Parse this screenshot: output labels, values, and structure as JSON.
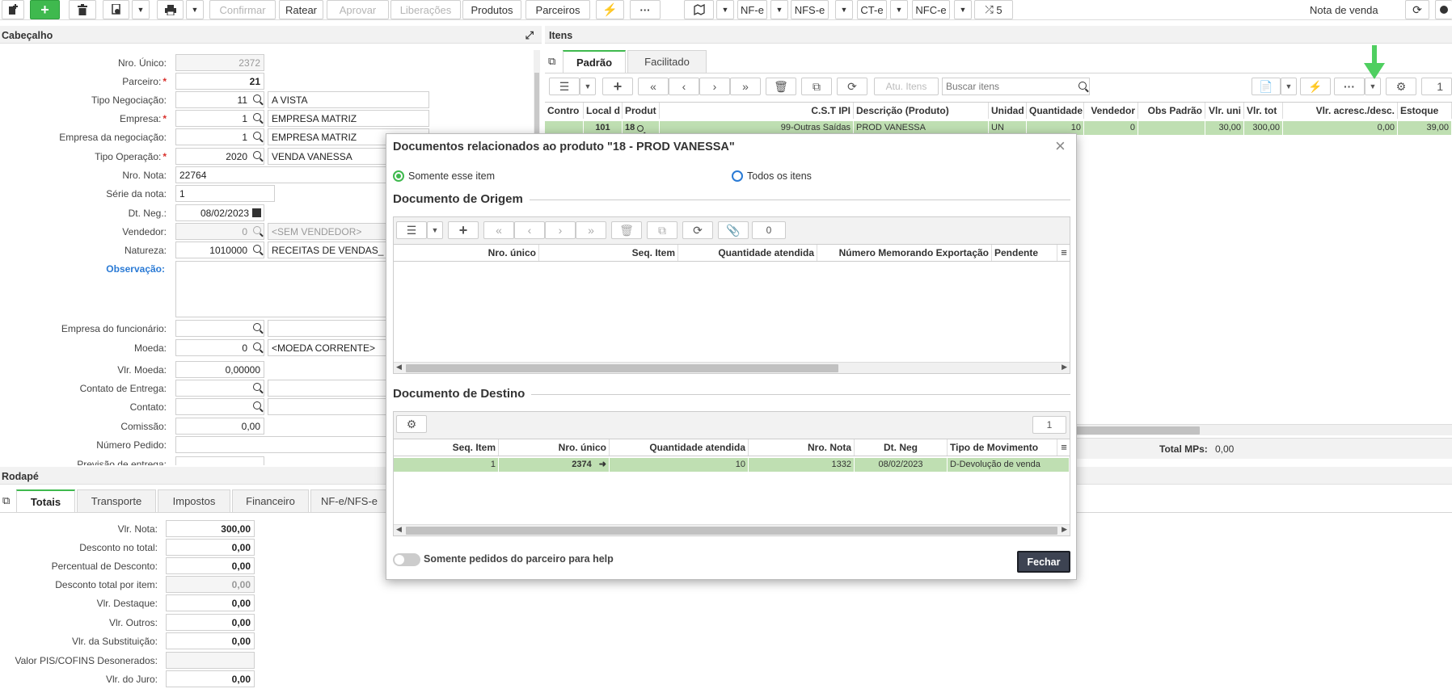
{
  "toolbar": {
    "confirmar": "Confirmar",
    "ratear": "Ratear",
    "aprovar": "Aprovar",
    "liberacoes": "Liberações",
    "produtos": "Produtos",
    "parceiros": "Parceiros",
    "nfe": "NF-e",
    "nfse": "NFS-e",
    "cte": "CT-e",
    "nfce": "NFC-e",
    "shuffle_count": "5",
    "right_title": "Nota de venda"
  },
  "header": {
    "title": "Cabeçalho",
    "fields": [
      {
        "label": "Nro. Único:",
        "value": "2372"
      },
      {
        "label": "Parceiro:",
        "value": "21"
      },
      {
        "label": "Tipo Negociação:",
        "value": "11",
        "desc": "A VISTA"
      },
      {
        "label": "Empresa:",
        "value": "1",
        "desc": "EMPRESA MATRIZ"
      },
      {
        "label": "Empresa da negociação:",
        "value": "1",
        "desc": "EMPRESA MATRIZ"
      },
      {
        "label": "Tipo Operação:",
        "value": "2020",
        "desc": "VENDA VANESSA"
      },
      {
        "label": "Nro. Nota:",
        "value": "22764"
      },
      {
        "label": "Série da nota:",
        "value": "1"
      },
      {
        "label": "Dt. Neg.:",
        "value": "08/02/2023"
      },
      {
        "label": "Vendedor:",
        "value": "0",
        "desc": "<SEM VENDEDOR>"
      },
      {
        "label": "Natureza:",
        "value": "1010000",
        "desc": "RECEITAS DE VENDAS_"
      },
      {
        "label": "Observação:"
      },
      {
        "label": "Empresa do funcionário:"
      },
      {
        "label": "Moeda:",
        "value": "0",
        "desc": "<MOEDA CORRENTE>"
      },
      {
        "label": "Vlr. Moeda:",
        "value": "0,00000"
      },
      {
        "label": "Contato de Entrega:"
      },
      {
        "label": "Contato:"
      },
      {
        "label": "Comissão:",
        "value": "0,00"
      },
      {
        "label": "Número Pedido:"
      },
      {
        "label": "Previsão de entrega:"
      }
    ]
  },
  "footer": {
    "title": "Rodapé",
    "tabs": [
      "Totais",
      "Transporte",
      "Impostos",
      "Financeiro",
      "NF-e/NFS-e"
    ],
    "fields": [
      {
        "label": "Vlr. Nota:",
        "value": "300,00"
      },
      {
        "label": "Desconto no total:",
        "value": "0,00"
      },
      {
        "label": "Percentual de Desconto:",
        "value": "0,00"
      },
      {
        "label": "Desconto total por item:",
        "value": "0,00"
      },
      {
        "label": "Vlr. Destaque:",
        "value": "0,00"
      },
      {
        "label": "Vlr. Outros:",
        "value": "0,00"
      },
      {
        "label": "Vlr. da Substituição:",
        "value": "0,00"
      },
      {
        "label": "Valor PIS/COFINS Desonerados:",
        "value": ""
      },
      {
        "label": "Vlr. do Juro:",
        "value": "0,00"
      }
    ]
  },
  "items": {
    "title": "Itens",
    "tabs": [
      "Padrão",
      "Facilitado"
    ],
    "atu_label": "Atu. Itens",
    "search_placeholder": "Buscar itens",
    "page_input": "1",
    "columns": [
      "Contro",
      "Local d",
      "Produt",
      "C.S.T IPI",
      "Descrição (Produto)",
      "Unidad",
      "Quantidade",
      "Vendedor",
      "Obs Padrão",
      "Vlr. uni",
      "Vlr. tot",
      "Vlr. acresc./desc.",
      "Estoque"
    ],
    "row": [
      "",
      "101",
      "18",
      "99-Outras Saídas",
      "PROD VANESSA",
      "UN",
      "10",
      "0",
      "",
      "30,00",
      "300,00",
      "0,00",
      "39,00"
    ],
    "total_mps_label": "Total MPs:",
    "total_mps_value": "0,00"
  },
  "modal": {
    "title": "Documentos relacionados ao produto \"18 - PROD VANESSA\"",
    "radio_only": "Somente esse item",
    "radio_all": "Todos os itens",
    "origin": {
      "title": "Documento de Origem",
      "count": "0",
      "columns": [
        "Nro. único",
        "Seq. Item",
        "Quantidade atendida",
        "Número Memorando Exportação",
        "Pendente"
      ]
    },
    "dest": {
      "title": "Documento de Destino",
      "count": "1",
      "columns": [
        "Seq. Item",
        "Nro. único",
        "Quantidade atendida",
        "Nro. Nota",
        "Dt. Neg",
        "Tipo de Movimento"
      ],
      "row": [
        "1",
        "2374",
        "10",
        "1332",
        "08/02/2023",
        "D-Devolução de venda"
      ]
    },
    "toggle_label": "Somente pedidos do parceiro para help",
    "close_label": "Fechar"
  },
  "colors": {
    "green": "#3fb94e",
    "row_green": "#bfdfb2",
    "link_blue": "#2a7ad5",
    "dark_button": "#3d4352"
  }
}
